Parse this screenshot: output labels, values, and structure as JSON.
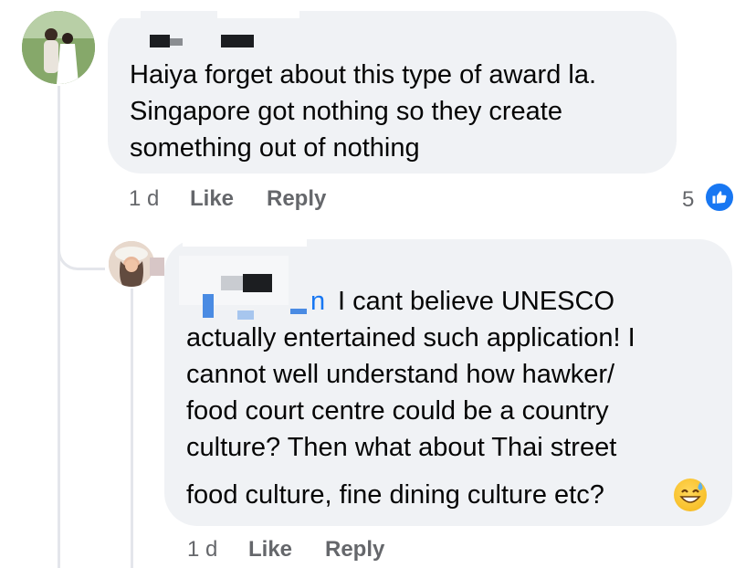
{
  "comments": [
    {
      "text_lines": [
        "Haiya forget about this type of award la.",
        "Singapore got nothing so they create",
        "something out of nothing"
      ],
      "time": "1 d",
      "like_label": "Like",
      "reply_label": "Reply",
      "reaction_count": "5",
      "reaction_icon": "thumbs-up-icon"
    },
    {
      "text_lines": [
        "I cant believe UNESCO",
        "actually entertained such application! I",
        "cannot well understand how hawker/",
        "food court centre could be a country",
        "culture? Then what about Thai street",
        "food culture, fine dining culture etc?"
      ],
      "mention_fragment": "n",
      "emoji": "sweat-smile-icon",
      "time": "1 d",
      "like_label": "Like",
      "reply_label": "Reply"
    }
  ],
  "colors": {
    "bubble": "#f0f2f5",
    "meta_text": "#65676b",
    "like_blue": "#1877f2"
  }
}
